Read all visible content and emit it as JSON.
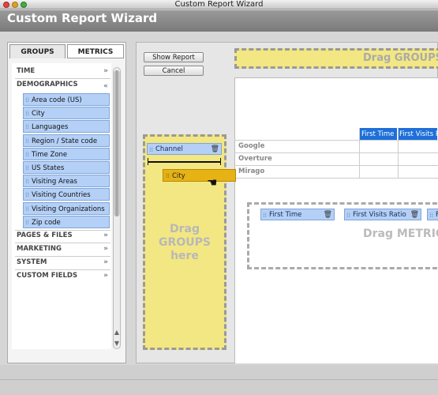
{
  "window": {
    "title": "Custom Report Wizard"
  },
  "header": {
    "title": "Custom Report Wizard"
  },
  "tabs": {
    "groups": "GROUPS",
    "metrics": "METRICS"
  },
  "categories": {
    "time": "TIME",
    "demographics": "DEMOGRAPHICS",
    "pages_files": "PAGES & FILES",
    "marketing": "MARKETING",
    "system": "SYSTEM",
    "custom_fields": "CUSTOM FIELDS"
  },
  "demographic_items": [
    "Area code (US)",
    "City",
    "Languages",
    "Region / State code",
    "Time Zone",
    "US States",
    "Visiting Areas",
    "Visiting Countries",
    "Visiting Organizations",
    "Zip code"
  ],
  "buttons": {
    "show_report": "Show Report",
    "cancel": "Cancel"
  },
  "drop_zones": {
    "top": "Drag GROUPS",
    "groups": "Drag GROUPS here",
    "metrics": "Drag METRICS"
  },
  "group_chips": {
    "channel": "Channel"
  },
  "drag_chip": {
    "label": "City"
  },
  "table": {
    "columns": [
      "First Time",
      "First Visits R"
    ],
    "rows": [
      "Google",
      "Overture",
      "Mirago"
    ]
  },
  "metric_chips": [
    "First Time",
    "First Visits Ratio",
    "F"
  ],
  "colors": {
    "selected_item": "#b4d0f7",
    "drop_zone": "#f3e783",
    "table_header": "#1e6fd9",
    "drag_chip": "#e6b214"
  }
}
